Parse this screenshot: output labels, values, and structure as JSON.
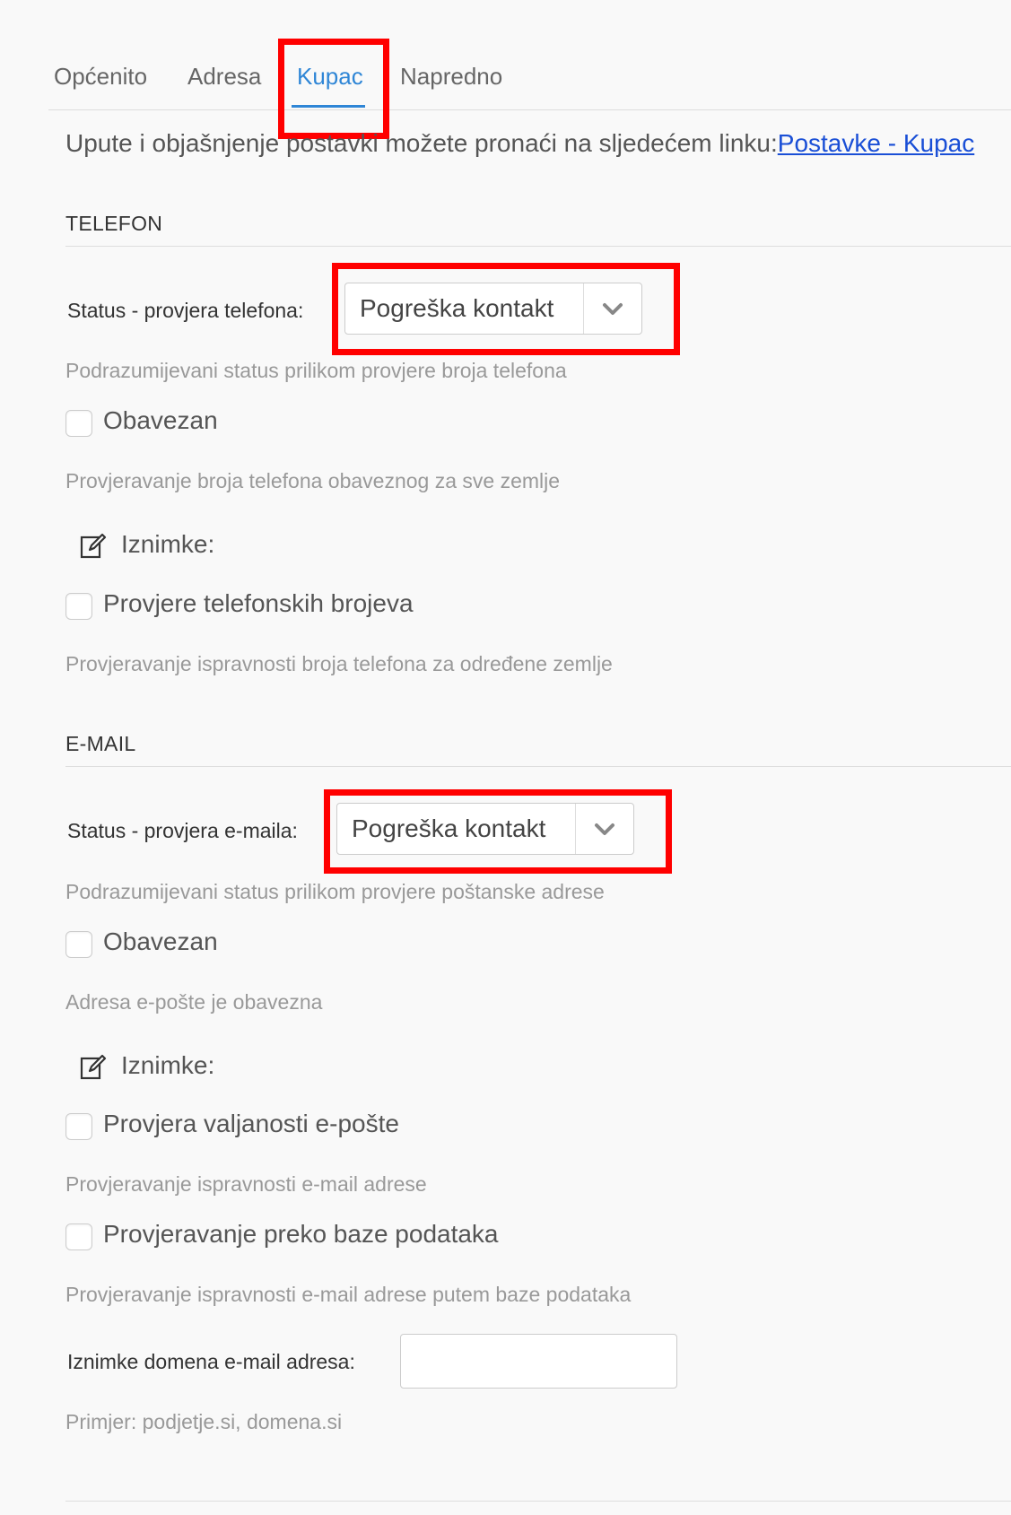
{
  "tabs": [
    {
      "label": "Općenito"
    },
    {
      "label": "Adresa"
    },
    {
      "label": "Kupac",
      "active": true
    },
    {
      "label": "Napredno"
    }
  ],
  "intro": {
    "text": "Upute i objašnjenje postavki možete pronaći na sljedećem linku:",
    "link": "Postavke - Kupac"
  },
  "telefon": {
    "title": "TELEFON",
    "status_label": "Status - provjera telefona:",
    "status_value": "Pogreška kontakt",
    "status_help": "Podrazumijevani status prilikom provjere broja telefona",
    "required_label": "Obavezan",
    "required_help": "Provjeravanje broja telefona obaveznog za sve zemlje",
    "exceptions_label": "Iznimke:",
    "check_numbers_label": "Provjere telefonskih brojeva",
    "check_numbers_help": "Provjeravanje ispravnosti broja telefona za određene zemlje"
  },
  "email": {
    "title": "E-MAIL",
    "status_label": "Status - provjera e-maila:",
    "status_value": "Pogreška kontakt",
    "status_help": "Podrazumijevani status prilikom provjere poštanske adrese",
    "required_label": "Obavezan",
    "required_help": "Adresa e-pošte je obavezna",
    "exceptions_label": "Iznimke:",
    "validity_label": "Provjera valjanosti e-pošte",
    "validity_help": "Provjeravanje ispravnosti e-mail adrese",
    "db_label": "Provjeravanje preko baze podataka",
    "db_help": "Provjeravanje ispravnosti e-mail adrese putem baze podataka",
    "domain_label": "Iznimke domena e-mail adresa:",
    "domain_value": "",
    "domain_help": "Primjer: podjetje.si, domena.si"
  },
  "colors": {
    "accent": "#2f86d6",
    "highlight": "#ff0000",
    "link": "#1a4fd6"
  },
  "icons": {
    "select_arrow": "chevron-down-icon",
    "exceptions": "edit-icon"
  }
}
